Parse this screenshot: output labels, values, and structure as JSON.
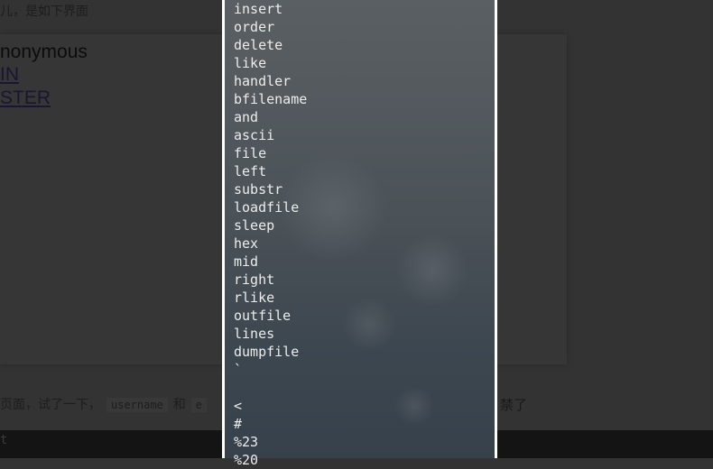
{
  "background": {
    "top_text": "儿，是如下界面",
    "user_label": "nonymous",
    "links": [
      "IN",
      "STER"
    ],
    "paragraph_prefix": "页面，试了一下，",
    "code1": "username",
    "paragraph_mid": "和",
    "code2": "e",
    "paragraph_end": "禁了",
    "bottom_text": "t"
  },
  "panel": {
    "items": [
      "insert",
      "order",
      "delete",
      "like",
      "handler",
      "bfilename",
      "and",
      "ascii",
      "file",
      "left",
      "substr",
      "loadfile",
      "sleep",
      "hex",
      "mid",
      "right",
      "rlike",
      "outfile",
      "lines",
      "dumpfile",
      "`",
      " ",
      "<",
      "#",
      "%23",
      "%20"
    ]
  }
}
